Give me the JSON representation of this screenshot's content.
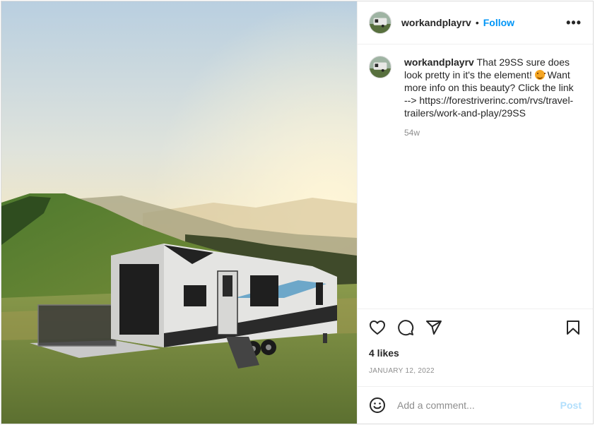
{
  "post": {
    "image_alt": "Travel trailer with open rear ramp patio parked in a mountain meadow at sunset",
    "account": {
      "username": "workandplayrv",
      "separator": "•",
      "follow_label": "Follow",
      "more_icon": "more-horizontal-icon"
    },
    "caption": {
      "username": "workandplayrv",
      "text_part1": "That 29SS sure does look pretty in it's the element!",
      "emoji": "smiling-face-emoji",
      "text_part2": "Want more info on this beauty? Click the link --> https://forestriverinc.com/rvs/travel-trailers/work-and-play/29SS",
      "time_ago": "54w"
    },
    "actions": {
      "like_icon": "heart-icon",
      "comment_icon": "comment-icon",
      "share_icon": "share-icon",
      "save_icon": "bookmark-icon"
    },
    "likes_label": "4 likes",
    "date_label": "JANUARY 12, 2022",
    "comment_box": {
      "emoji_icon": "emoji-icon",
      "placeholder": "Add a comment...",
      "post_label": "Post"
    },
    "colors": {
      "accent": "#0095f6",
      "post_disabled": "#b2dffc",
      "muted": "#8e8e8e"
    }
  }
}
